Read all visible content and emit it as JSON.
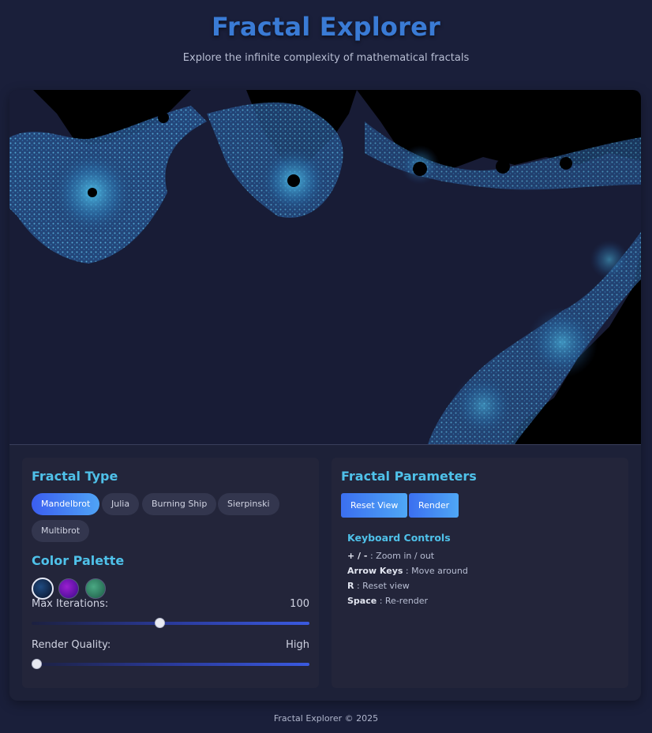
{
  "header": {
    "title": "Fractal Explorer",
    "subtitle": "Explore the infinite complexity of mathematical fractals"
  },
  "fractal_type": {
    "title": "Fractal Type",
    "options": [
      "Mandelbrot",
      "Julia",
      "Burning Ship",
      "Sierpinski",
      "Multibrot"
    ],
    "selected": "Mandelbrot"
  },
  "color_palette": {
    "title": "Color Palette",
    "swatches": [
      "blue-ocean",
      "purple-violet",
      "green-emerald"
    ],
    "selected": "blue-ocean",
    "colors": [
      "#1e4a80",
      "#9a1fd0",
      "#4aa883"
    ]
  },
  "max_iterations": {
    "label": "Max Iterations:",
    "value": "100",
    "level": 0.46
  },
  "render_quality": {
    "label": "Render Quality:",
    "value": "High",
    "level": 0.0
  },
  "parameters": {
    "title": "Fractal Parameters",
    "reset_label": "Reset View",
    "render_label": "Render"
  },
  "keyboard": {
    "title": "Keyboard Controls",
    "items": [
      {
        "key": "+ / -",
        "desc": ": Zoom in / out"
      },
      {
        "key": "Arrow Keys",
        "desc": ": Move around"
      },
      {
        "key": "R",
        "desc": ": Reset view"
      },
      {
        "key": "Space",
        "desc": ": Re-render"
      }
    ]
  },
  "footer": {
    "text": "Fractal Explorer © 2025"
  },
  "colors": {
    "accent": "#4fc1e9",
    "title": "#3a7bd5",
    "background": "#1a1f3a"
  }
}
